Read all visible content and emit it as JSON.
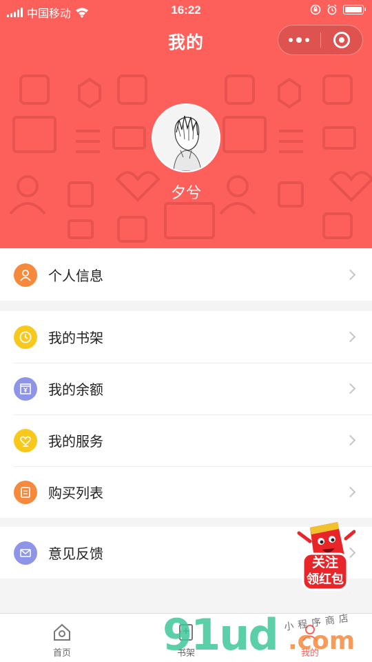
{
  "status_bar": {
    "carrier": "中国移动",
    "time": "16:22"
  },
  "nav": {
    "title": "我的"
  },
  "profile": {
    "username": "夕兮"
  },
  "menu_groups": [
    {
      "items": [
        {
          "label": "个人信息",
          "icon": "person-icon",
          "color": "#f7893c"
        }
      ]
    },
    {
      "items": [
        {
          "label": "我的书架",
          "icon": "clock-icon",
          "color": "#f8c81c"
        },
        {
          "label": "我的余额",
          "icon": "wallet-icon",
          "color": "#8e95e8"
        },
        {
          "label": "我的服务",
          "icon": "heart-icon",
          "color": "#f8c81c"
        },
        {
          "label": "购买列表",
          "icon": "list-icon",
          "color": "#f7893c"
        }
      ]
    },
    {
      "items": [
        {
          "label": "意见反馈",
          "icon": "mail-icon",
          "color": "#8e95e8"
        }
      ]
    }
  ],
  "tabbar": {
    "tabs": [
      {
        "label": "首页",
        "icon": "home-icon"
      },
      {
        "label": "书架",
        "icon": "bookshelf-icon"
      },
      {
        "label": "我的",
        "icon": "profile-icon"
      }
    ]
  },
  "promo": {
    "line1": "关注",
    "line2": "领红包"
  },
  "watermark": {
    "brand": "91ud",
    "domain": ".com",
    "tagline": "小程序商店"
  },
  "colors": {
    "header": "#fd5f5a",
    "page_bg": "#f4f4f4"
  }
}
